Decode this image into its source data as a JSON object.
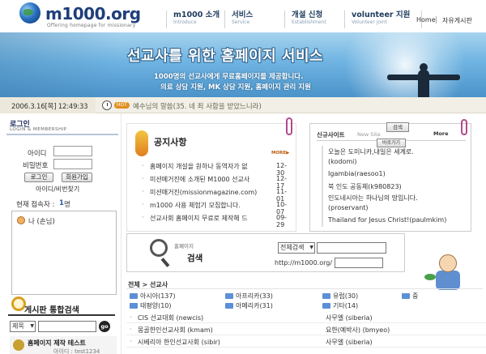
{
  "header": {
    "logo_text": "m1000.org",
    "logo_tagline": "Offering homepage for missionary",
    "nav": [
      {
        "label": "m1000 소개",
        "sub": "Introduce"
      },
      {
        "label": "서비스",
        "sub": "Service"
      },
      {
        "label": "개설 신청",
        "sub": "Establishment"
      },
      {
        "label": "volunteer 지원",
        "sub": "Volunteer joint"
      }
    ],
    "util_home": "Home",
    "util_board": "자유게시판"
  },
  "banner": {
    "title": "선교사를 위한 홈페이지 서비스",
    "line1": "1000명의 선교사에게 무료홈페이지를 제공합니다.",
    "line2": "의료 상담 지원, MK 상담 지원, 홈페이지 관리 지원"
  },
  "statusbar": {
    "date": "2006.3.16[목] 12:49:33",
    "hot": "HOT",
    "verse": "예수님의 말씀(35. 네 죄 사함을 받았느니라)"
  },
  "login": {
    "title": "로그인",
    "subtitle": "LOGIN & MEMBERSHIP",
    "id_label": "아이디",
    "pw_label": "비밀번호",
    "login_button": "로그인",
    "join_button": "회원가입",
    "find_link": "아이디/비번찾기",
    "visitors_label": "현재 접속자 : ",
    "visitors_count": "1",
    "visitors_unit": "명",
    "users": [
      "나 (손님)"
    ]
  },
  "board_search": {
    "title": "게시판 통합검색",
    "scope": "제목",
    "go": "go"
  },
  "test_banner": {
    "title": "홈페이지 제작 테스트",
    "sub": "아이디 : test1234"
  },
  "notice": {
    "title": "공지사항",
    "more": "MORE▶",
    "items": [
      {
        "title": "홈페이지 개설을 원하나 동역자가 없",
        "date": "12-30"
      },
      {
        "title": "미션메거진에 소개된 M1000 선교사",
        "date": "12-17"
      },
      {
        "title": "미션매거진(missionmagazine.com)",
        "date": "11-01"
      },
      {
        "title": "m1000 사용 체험기 모집합니다.",
        "date": "10-07"
      },
      {
        "title": "선교사회 홈페이지 무료로 제작해 드",
        "date": "09-29"
      }
    ]
  },
  "newsites": {
    "title": "신규사이트",
    "subtitle": "New Site",
    "more": "More",
    "items": [
      "오늘은 도미니카,내일은 세계로.",
      "(kodomi)",
      "Igambia(raesoo1)",
      "북 인도 공동체(k980823)",
      "인도네시아는 하나님의 땅입니다.",
      "(proservant)",
      "Thailand for Jesus Christ!(paulmkim)"
    ]
  },
  "hp_search": {
    "label_top": "홈페이지",
    "label": "검색",
    "select": "전체검색",
    "search_button": "검색",
    "url_label": "http://m1000.org/",
    "go_button": "바로가기"
  },
  "directory": {
    "crumb": "전체 > 선교사",
    "categories": [
      "아시아(137)",
      "아프리카(33)",
      "유럽(30)",
      "중",
      "태평양(10)",
      "아메리카(31)",
      "기타(14)"
    ],
    "rows": [
      {
        "name": "CIS 선교대회 (newcis)",
        "owner": "사무엘 (siberia)"
      },
      {
        "name": "몽골한인선교사회 (kmam)",
        "owner": "요한(예박사) (bmyeo)"
      },
      {
        "name": "시베리아 한인선교사회 (sibir)",
        "owner": "사무엘 (siberia)"
      }
    ]
  },
  "colors": {
    "banner_sky": "#6fb4e2",
    "nav_text": "#1e3b5d",
    "hot_badge": "#e09020",
    "folder": "#5c8fd6"
  }
}
